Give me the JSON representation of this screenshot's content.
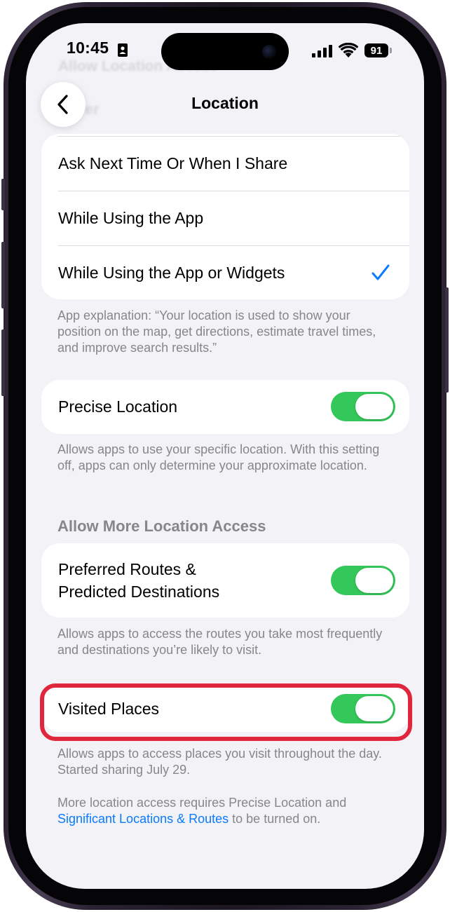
{
  "status_bar": {
    "time": "10:45",
    "battery": "91"
  },
  "ghost_text": {
    "line1": "Allow Location Access",
    "line2": "Never"
  },
  "nav": {
    "title": "Location"
  },
  "options": [
    "Ask Next Time Or When I Share",
    "While Using the App",
    "While Using the App or Widgets"
  ],
  "selected_option_index": 2,
  "app_explanation": "App explanation: “Your location is used to show your position on the map, get directions, estimate travel times, and improve search results.”",
  "precise_location": {
    "label": "Precise Location",
    "on": true,
    "footnote": "Allows apps to use your specific location. With this setting off, apps can only determine your approximate location."
  },
  "more_access": {
    "header": "Allow More Location Access",
    "routes": {
      "label_line1": "Preferred Routes &",
      "label_line2": "Predicted Destinations",
      "on": true,
      "footnote": "Allows apps to access the routes you take most frequently and destinations you’re likely to visit."
    },
    "visited": {
      "label": "Visited Places",
      "on": true,
      "footnote": "Allows apps to access places you visit throughout the day. Started sharing July 29."
    }
  },
  "bottom_note": {
    "text": "More location access requires Precise Location and",
    "link": "Significant Locations & Routes",
    "suffix": " to be turned on."
  },
  "colors": {
    "accent": "#0a7aff",
    "toggle_on": "#34c759",
    "highlight": "#e0263c",
    "background": "#f2f2f7"
  }
}
